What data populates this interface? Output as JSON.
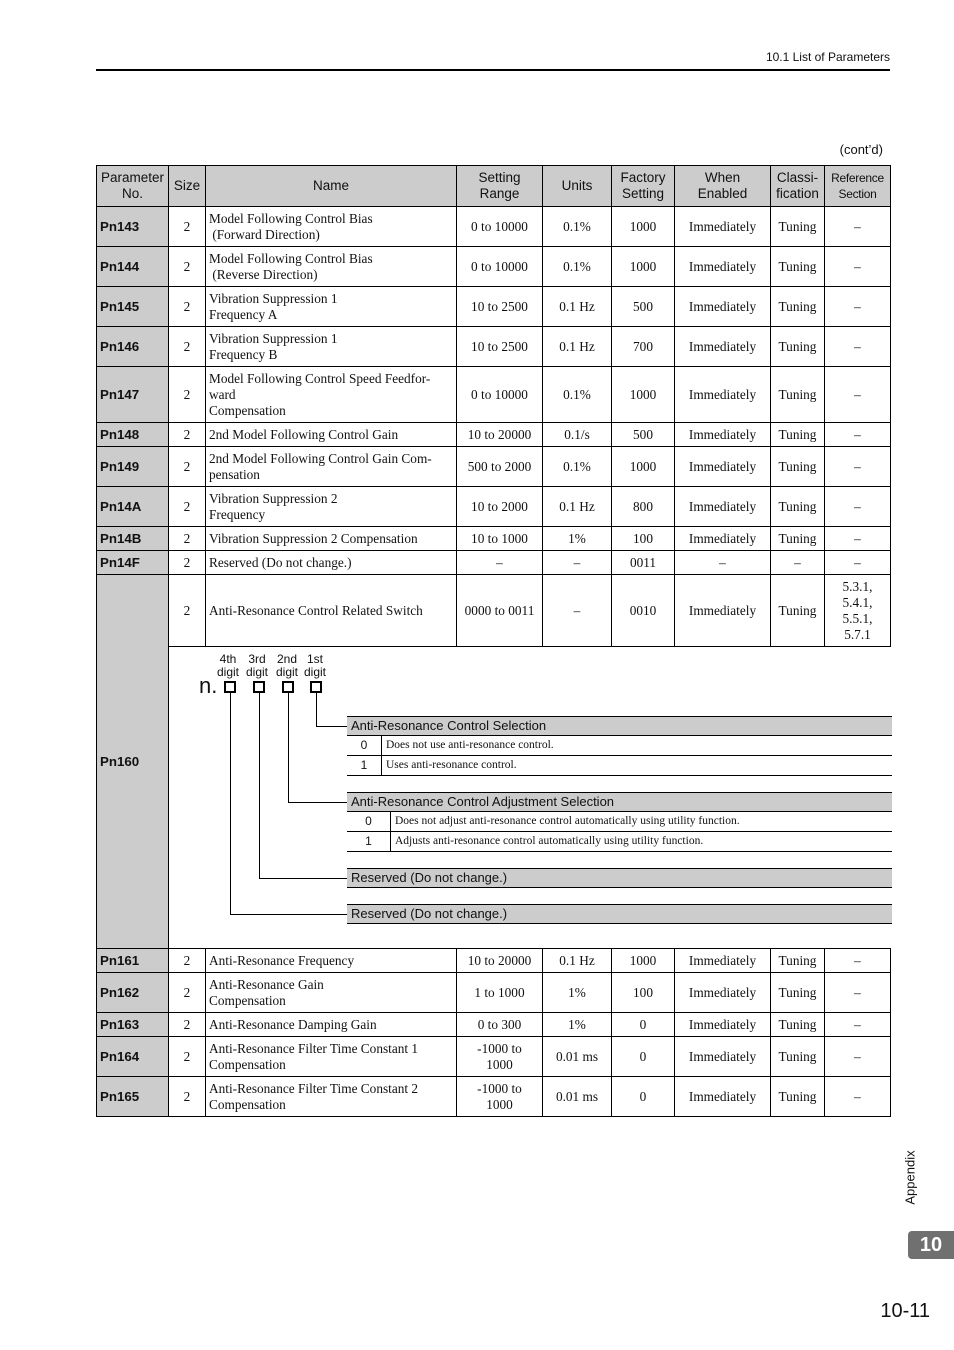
{
  "header": {
    "section": "10.1  List of Parameters",
    "contd": "(cont’d)"
  },
  "table": {
    "headers": [
      "Parameter No.",
      "Size",
      "Name",
      "Setting Range",
      "Units",
      "Factory Setting",
      "When Enabled",
      "Classi-fication",
      "Reference Section"
    ],
    "header_lines": {
      "param": [
        "Parameter",
        "No."
      ],
      "range": [
        "Setting",
        "Range"
      ],
      "factory": [
        "Factory",
        "Setting"
      ],
      "when": [
        "When",
        "Enabled"
      ],
      "class": [
        "Classi-",
        "fication"
      ],
      "ref": [
        "Reference",
        "Section"
      ]
    },
    "rows": [
      {
        "no": "Pn143",
        "size": "2",
        "name": [
          "Model Following Control Bias",
          " (Forward Direction)"
        ],
        "range": "0 to 10000",
        "units": "0.1%",
        "factory": "1000",
        "when": "Immediately",
        "class": "Tuning",
        "ref": "–"
      },
      {
        "no": "Pn144",
        "size": "2",
        "name": [
          "Model Following Control Bias",
          " (Reverse Direction)"
        ],
        "range": "0 to 10000",
        "units": "0.1%",
        "factory": "1000",
        "when": "Immediately",
        "class": "Tuning",
        "ref": "–"
      },
      {
        "no": "Pn145",
        "size": "2",
        "name": [
          "Vibration Suppression 1",
          "Frequency A"
        ],
        "range": "10 to 2500",
        "units": "0.1 Hz",
        "factory": "500",
        "when": "Immediately",
        "class": "Tuning",
        "ref": "–"
      },
      {
        "no": "Pn146",
        "size": "2",
        "name": [
          "Vibration Suppression 1",
          "Frequency B"
        ],
        "range": "10 to 2500",
        "units": "0.1 Hz",
        "factory": "700",
        "when": "Immediately",
        "class": "Tuning",
        "ref": "–"
      },
      {
        "no": "Pn147",
        "size": "2",
        "name": [
          "Model Following Control Speed Feedfor-",
          "ward",
          "Compensation"
        ],
        "range": "0 to 10000",
        "units": "0.1%",
        "factory": "1000",
        "when": "Immediately",
        "class": "Tuning",
        "ref": "–"
      },
      {
        "no": "Pn148",
        "size": "2",
        "name": [
          "2nd Model Following Control Gain"
        ],
        "range": "10 to 20000",
        "units": "0.1/s",
        "factory": "500",
        "when": "Immediately",
        "class": "Tuning",
        "ref": "–"
      },
      {
        "no": "Pn149",
        "size": "2",
        "name": [
          "2nd Model Following Control Gain Com-",
          "pensation"
        ],
        "range": "500 to 2000",
        "units": "0.1%",
        "factory": "1000",
        "when": "Immediately",
        "class": "Tuning",
        "ref": "–"
      },
      {
        "no": "Pn14A",
        "size": "2",
        "name": [
          "Vibration Suppression 2",
          "Frequency"
        ],
        "range": "10 to 2000",
        "units": "0.1 Hz",
        "factory": "800",
        "when": "Immediately",
        "class": "Tuning",
        "ref": "–"
      },
      {
        "no": "Pn14B",
        "size": "2",
        "name": [
          "Vibration Suppression 2 Compensation"
        ],
        "range": "10 to 1000",
        "units": "1%",
        "factory": "100",
        "when": "Immediately",
        "class": "Tuning",
        "ref": "–"
      },
      {
        "no": "Pn14F",
        "size": "2",
        "name": [
          "Reserved (Do not change.)"
        ],
        "range": "–",
        "units": "–",
        "factory": "0011",
        "when": "–",
        "class": "–",
        "ref": "–"
      }
    ],
    "pn160": {
      "no": "Pn160",
      "size": "2",
      "name": "Anti-Resonance Control Related Switch",
      "range": "0000 to 0011",
      "units": "–",
      "factory": "0010",
      "when": "Immediately",
      "class": "Tuning",
      "ref": [
        "5.3.1,",
        "5.4.1,",
        "5.5.1,",
        "5.7.1"
      ],
      "diagram": {
        "prefix": "n.",
        "digits": [
          {
            "ordinal": "4th",
            "word": "digit"
          },
          {
            "ordinal": "3rd",
            "word": "digit"
          },
          {
            "ordinal": "2nd",
            "word": "digit"
          },
          {
            "ordinal": "1st",
            "word": "digit"
          }
        ],
        "groups": [
          {
            "title": "Anti-Resonance Control Selection",
            "options": [
              {
                "value": "0",
                "desc": "Does not use anti-resonance control."
              },
              {
                "value": "1",
                "desc": "Uses anti-resonance control."
              }
            ]
          },
          {
            "title": "Anti-Resonance Control Adjustment Selection",
            "options": [
              {
                "value": "0",
                "desc": "Does not adjust anti-resonance control automatically using utility function."
              },
              {
                "value": "1",
                "desc": "Adjusts anti-resonance control automatically using utility function."
              }
            ]
          },
          {
            "title": "Reserved (Do not change.)",
            "options": []
          },
          {
            "title": "Reserved (Do not change.)",
            "options": []
          }
        ]
      }
    },
    "rows_after": [
      {
        "no": "Pn161",
        "size": "2",
        "name": [
          "Anti-Resonance Frequency"
        ],
        "range": [
          "10 to 20000"
        ],
        "units": "0.1 Hz",
        "factory": "1000",
        "when": "Immediately",
        "class": "Tuning",
        "ref": "–"
      },
      {
        "no": "Pn162",
        "size": "2",
        "name": [
          "Anti-Resonance Gain",
          "Compensation"
        ],
        "range": [
          "1 to 1000"
        ],
        "units": "1%",
        "factory": "100",
        "when": "Immediately",
        "class": "Tuning",
        "ref": "–"
      },
      {
        "no": "Pn163",
        "size": "2",
        "name": [
          "Anti-Resonance Damping Gain"
        ],
        "range": [
          "0 to 300"
        ],
        "units": "1%",
        "factory": "0",
        "when": "Immediately",
        "class": "Tuning",
        "ref": "–"
      },
      {
        "no": "Pn164",
        "size": "2",
        "name": [
          "Anti-Resonance Filter Time Constant 1",
          "Compensation"
        ],
        "range": [
          "-1000 to",
          "1000"
        ],
        "units": "0.01 ms",
        "factory": "0",
        "when": "Immediately",
        "class": "Tuning",
        "ref": "–"
      },
      {
        "no": "Pn165",
        "size": "2",
        "name": [
          "Anti-Resonance Filter Time Constant 2",
          "Compensation"
        ],
        "range": [
          "-1000 to",
          "1000"
        ],
        "units": "0.01 ms",
        "factory": "0",
        "when": "Immediately",
        "class": "Tuning",
        "ref": "–"
      }
    ]
  },
  "footer": {
    "side_label": "Appendix",
    "chapter": "10",
    "page": "10-11"
  }
}
